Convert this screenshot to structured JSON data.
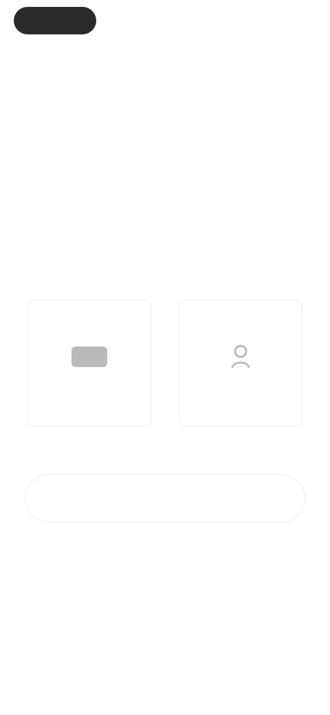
{
  "topbar": {
    "pill_label": "",
    "skip_label": ""
  },
  "header": {
    "title": "",
    "subtitle": ""
  },
  "choices": [
    {
      "label": "",
      "icon": "grid-icon"
    },
    {
      "label": "",
      "icon": "person-icon"
    }
  ],
  "actions": {
    "continue_label": ""
  },
  "colors": {
    "pill_bg": "#2b2b2b",
    "card_border": "#ececec",
    "text_muted": "#7a7a7a"
  }
}
